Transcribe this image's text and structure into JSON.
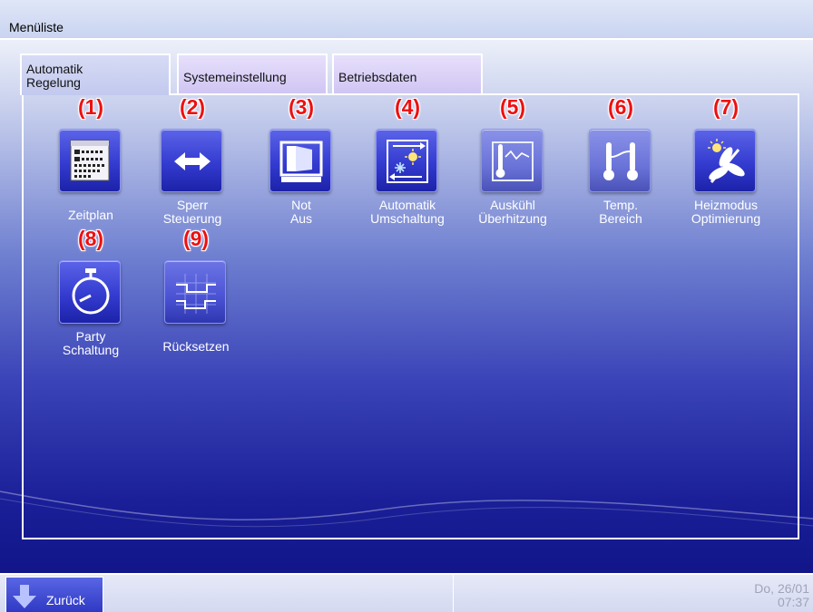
{
  "window": {
    "title": "Menüliste"
  },
  "tabs": [
    {
      "label": "Automatik\nRegelung",
      "active": true
    },
    {
      "label": "Systemeinstellung",
      "active": false
    },
    {
      "label": "Betriebsdaten",
      "active": false
    }
  ],
  "tiles": [
    {
      "number": "(1)",
      "label": "Zeitplan",
      "icon": "calendar-icon"
    },
    {
      "number": "(2)",
      "label": "Sperr\nSteuerung",
      "icon": "double-arrow-icon"
    },
    {
      "number": "(3)",
      "label": "Not\nAus",
      "icon": "emergency-stop-icon"
    },
    {
      "number": "(4)",
      "label": "Automatik\nUmschaltung",
      "icon": "auto-changeover-icon"
    },
    {
      "number": "(5)",
      "label": "Auskühl\nÜberhitzung",
      "icon": "thermometer-graph-icon"
    },
    {
      "number": "(6)",
      "label": "Temp.\nBereich",
      "icon": "temperature-range-icon"
    },
    {
      "number": "(7)",
      "label": "Heizmodus\nOptimierung",
      "icon": "fan-sun-icon"
    },
    {
      "number": "(8)",
      "label": "Party\nSchaltung",
      "icon": "stopwatch-icon"
    },
    {
      "number": "(9)",
      "label": "Rücksetzen",
      "icon": "reset-signal-icon"
    }
  ],
  "footer": {
    "back_label": "Zurück",
    "date": "Do, 26/01",
    "time": "07:37"
  },
  "colors": {
    "number_red": "#ee1010",
    "icon_blue": "#343bd0",
    "panel_border": "#ffffff"
  }
}
